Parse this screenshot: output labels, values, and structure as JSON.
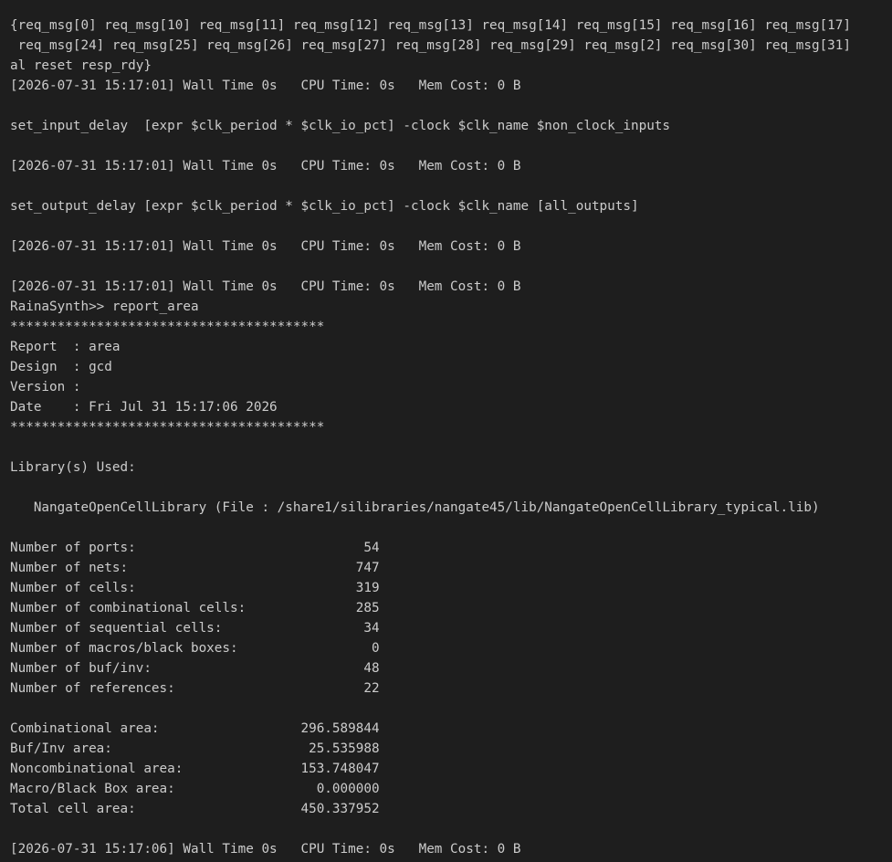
{
  "theme": {
    "background": "#1e1e1e",
    "foreground": "#cccccc"
  },
  "terminal": {
    "lines": [
      "{req_msg[0] req_msg[10] req_msg[11] req_msg[12] req_msg[13] req_msg[14] req_msg[15] req_msg[16] req_msg[17]",
      " req_msg[24] req_msg[25] req_msg[26] req_msg[27] req_msg[28] req_msg[29] req_msg[2] req_msg[30] req_msg[31]",
      "al reset resp_rdy}",
      "[2026-07-31 15:17:01] Wall Time 0s   CPU Time: 0s   Mem Cost: 0 B",
      "",
      "set_input_delay  [expr $clk_period * $clk_io_pct] -clock $clk_name $non_clock_inputs",
      "",
      "[2026-07-31 15:17:01] Wall Time 0s   CPU Time: 0s   Mem Cost: 0 B",
      "",
      "set_output_delay [expr $clk_period * $clk_io_pct] -clock $clk_name [all_outputs]",
      "",
      "[2026-07-31 15:17:01] Wall Time 0s   CPU Time: 0s   Mem Cost: 0 B",
      "",
      "[2026-07-31 15:17:01] Wall Time 0s   CPU Time: 0s   Mem Cost: 0 B",
      "RainaSynth>> report_area",
      "****************************************",
      "Report  : area",
      "Design  : gcd",
      "Version :",
      "Date    : Fri Jul 31 15:17:06 2026",
      "****************************************",
      "",
      "Library(s) Used:",
      "",
      "   NangateOpenCellLibrary (File : /share1/silibraries/nangate45/lib/NangateOpenCellLibrary_typical.lib)",
      "",
      "Number of ports:                             54",
      "Number of nets:                             747",
      "Number of cells:                            319",
      "Number of combinational cells:              285",
      "Number of sequential cells:                  34",
      "Number of macros/black boxes:                 0",
      "Number of buf/inv:                           48",
      "Number of references:                        22",
      "",
      "Combinational area:                  296.589844",
      "Buf/Inv area:                         25.535988",
      "Noncombinational area:               153.748047",
      "Macro/Black Box area:                  0.000000",
      "Total cell area:                     450.337952",
      "",
      "[2026-07-31 15:17:06] Wall Time 0s   CPU Time: 0s   Mem Cost: 0 B"
    ]
  }
}
